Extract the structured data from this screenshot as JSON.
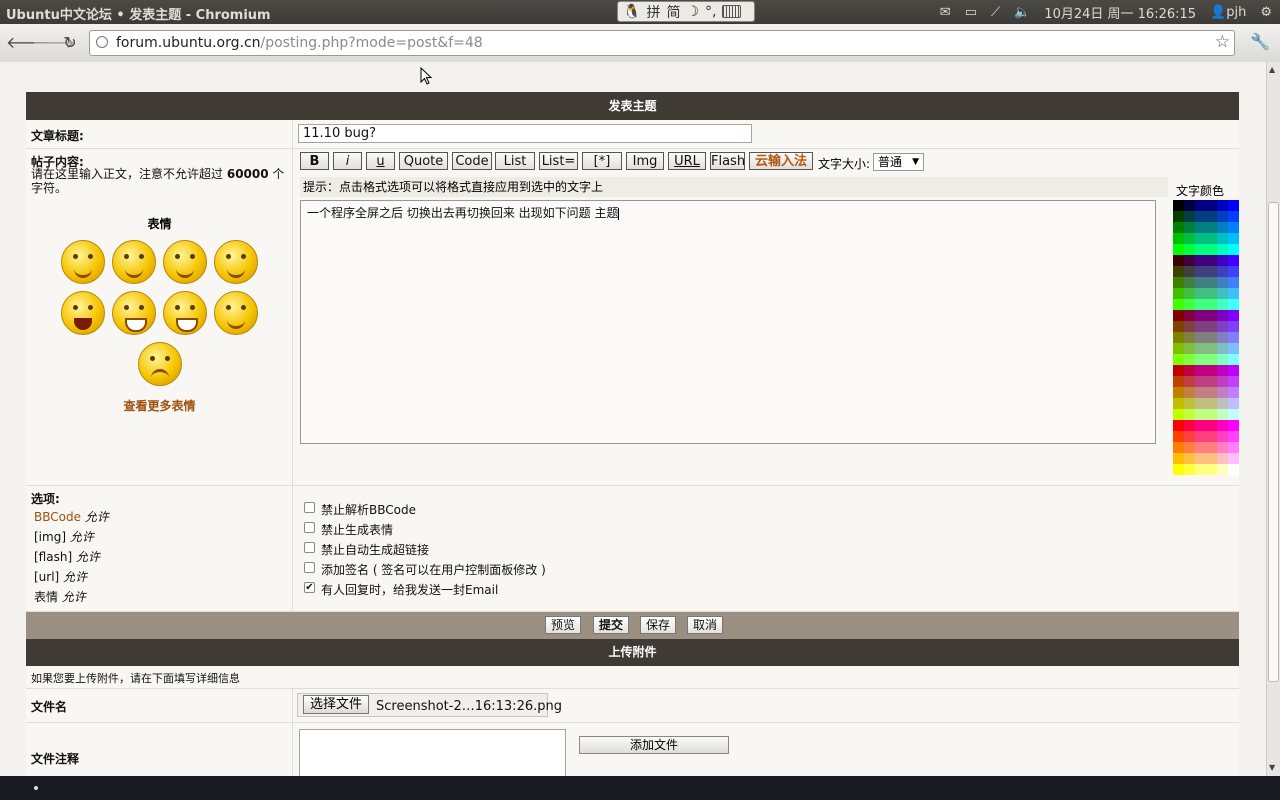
{
  "window": {
    "title": "Ubuntu中文论坛 • 发表主题 - Chromium",
    "ime": [
      "拼",
      "简"
    ],
    "clock": "10月24日 周一 16:26:15",
    "user": "pjh"
  },
  "browser": {
    "url_host": "forum.ubuntu.org.cn",
    "url_path": "/posting.php?mode=post&f=48"
  },
  "form": {
    "header": "发表主题",
    "subject_label": "文章标题:",
    "subject_value": "11.10 bug?",
    "content_label": "帖子内容:",
    "content_hint": "请在这里输入正文，注意不允许超过",
    "content_limit": "60000",
    "content_hint_suffix": "个字符。",
    "smilies_title": "表情",
    "more_smilies": "查看更多表情",
    "bbcode_buttons": [
      "B",
      "i",
      "u",
      "Quote",
      "Code",
      "List",
      "List=",
      "[*]",
      "Img",
      "URL",
      "Flash"
    ],
    "cloud_ime": "云输入法",
    "font_size_label": "文字大小:",
    "font_size_value": "普通",
    "format_hint": "提示：点击格式选项可以将格式直接应用到选中的文字上",
    "message_text": "一个程序全屏之后 切换出去再切换回来 出现如下问题 主题",
    "font_color_label": "文字颜色",
    "options_label": "选项:",
    "allowed": [
      {
        "name": "BBCode",
        "status": "允许",
        "link": true
      },
      {
        "name": "[img]",
        "status": "允许",
        "link": false
      },
      {
        "name": "[flash]",
        "status": "允许",
        "link": false
      },
      {
        "name": "[url]",
        "status": "允许",
        "link": false
      },
      {
        "name": "表情",
        "status": "允许",
        "link": false
      }
    ],
    "options": [
      {
        "label": "禁止解析BBCode",
        "checked": false
      },
      {
        "label": "禁止生成表情",
        "checked": false
      },
      {
        "label": "禁止自动生成超链接",
        "checked": false
      },
      {
        "label": "添加签名 ( 签名可以在用户控制面板修改 )",
        "checked": false
      },
      {
        "label": "有人回复时，给我发送一封Email",
        "checked": true
      }
    ],
    "submit_buttons": [
      "预览",
      "提交",
      "保存",
      "取消"
    ],
    "attach_header": "上传附件",
    "attach_hint": "如果您要上传附件，请在下面填写详细信息",
    "file_name_label": "文件名",
    "choose_file_button": "选择文件",
    "chosen_file": "Screenshot-2…16:13:26.png",
    "file_comment_label": "文件注释",
    "add_file_button": "添加文件"
  }
}
